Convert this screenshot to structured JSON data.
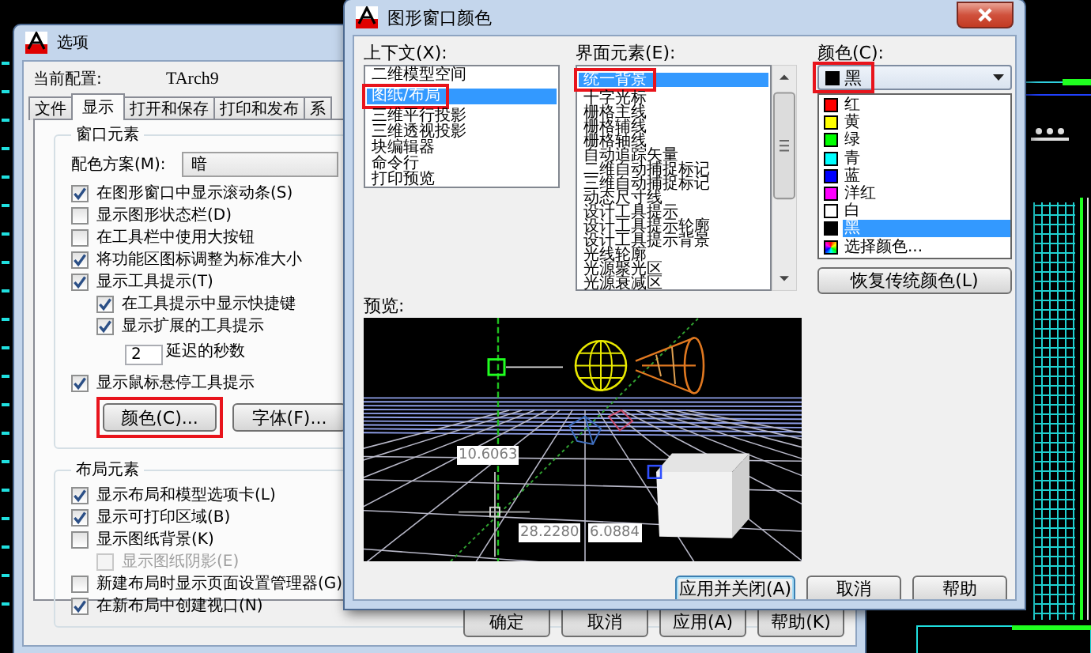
{
  "options_dialog": {
    "title": "选项",
    "profile_label": "当前配置:",
    "profile_value": "TArch9",
    "tabs": [
      {
        "label": "文件",
        "selected": false
      },
      {
        "label": "显示",
        "selected": true
      },
      {
        "label": "打开和保存",
        "selected": false
      },
      {
        "label": "打印和发布",
        "selected": false
      },
      {
        "label": "系",
        "selected": false
      }
    ],
    "window_group": {
      "title": "窗口元素",
      "scheme_label": "配色方案(M):",
      "scheme_value": "暗",
      "options": [
        {
          "kind": "check",
          "label": "在图形窗口中显示滚动条(S)",
          "checked": true,
          "disabled": false
        },
        {
          "kind": "check",
          "label": "显示图形状态栏(D)",
          "checked": false,
          "disabled": false
        },
        {
          "kind": "check",
          "label": "在工具栏中使用大按钮",
          "checked": false,
          "disabled": false
        },
        {
          "kind": "check",
          "label": "将功能区图标调整为标准大小",
          "checked": true,
          "disabled": false
        },
        {
          "kind": "check",
          "label": "显示工具提示(T)",
          "checked": true,
          "disabled": false,
          "children": [
            {
              "kind": "check",
              "label": "在工具提示中显示快捷键",
              "checked": true,
              "disabled": false
            },
            {
              "kind": "check",
              "label": "显示扩展的工具提示",
              "checked": true,
              "disabled": false
            },
            {
              "kind": "number",
              "value": "2",
              "suffix": "延迟的秒数"
            }
          ]
        },
        {
          "kind": "check",
          "label": "显示鼠标悬停工具提示",
          "checked": true,
          "disabled": false
        }
      ],
      "buttons": [
        {
          "label": "颜色(C)...",
          "highlighted": true
        },
        {
          "label": "字体(F)...",
          "highlighted": false
        }
      ]
    },
    "layout_group": {
      "title": "布局元素",
      "options": [
        {
          "kind": "check",
          "label": "显示布局和模型选项卡(L)",
          "checked": true,
          "disabled": false
        },
        {
          "kind": "check",
          "label": "显示可打印区域(B)",
          "checked": true,
          "disabled": false
        },
        {
          "kind": "check",
          "label": "显示图纸背景(K)",
          "checked": false,
          "disabled": false,
          "children": [
            {
              "kind": "check",
              "label": "显示图纸阴影(E)",
              "checked": false,
              "disabled": true
            }
          ]
        },
        {
          "kind": "check",
          "label": "新建布局时显示页面设置管理器(G)",
          "checked": false,
          "disabled": false
        },
        {
          "kind": "check",
          "label": "在新布局中创建视口(N)",
          "checked": true,
          "disabled": false
        }
      ]
    },
    "footer_buttons": [
      "确定",
      "取消",
      "应用(A)",
      "帮助(K)"
    ]
  },
  "color_dialog": {
    "title": "图形窗口颜色",
    "context": {
      "label": "上下文(X):",
      "highlight_selected": true,
      "items": [
        {
          "label": "二维模型空间",
          "selected": false
        },
        {
          "label": "图纸/布局",
          "selected": true
        },
        {
          "label": "三维平行投影",
          "selected": false
        },
        {
          "label": "三维透视投影",
          "selected": false
        },
        {
          "label": "块编辑器",
          "selected": false
        },
        {
          "label": "命令行",
          "selected": false
        },
        {
          "label": "打印预览",
          "selected": false
        }
      ]
    },
    "elements": {
      "label": "界面元素(E):",
      "highlight_selected": true,
      "items": [
        {
          "label": "统一背景",
          "selected": true
        },
        {
          "label": "十字光标",
          "selected": false
        },
        {
          "label": "栅格主线",
          "selected": false
        },
        {
          "label": "栅格辅线",
          "selected": false
        },
        {
          "label": "栅格轴线",
          "selected": false
        },
        {
          "label": "自动追踪矢量",
          "selected": false
        },
        {
          "label": "二维自动捕捉标记",
          "selected": false
        },
        {
          "label": "三维自动捕捉标记",
          "selected": false
        },
        {
          "label": "动态尺寸线",
          "selected": false
        },
        {
          "label": "设计工具提示",
          "selected": false
        },
        {
          "label": "设计工具提示轮廓",
          "selected": false
        },
        {
          "label": "设计工具提示背景",
          "selected": false
        },
        {
          "label": "光线轮廓",
          "selected": false
        },
        {
          "label": "光源聚光区",
          "selected": false
        },
        {
          "label": "光源衰减区",
          "selected": false
        }
      ]
    },
    "color": {
      "label": "颜色(C):",
      "value": "黑",
      "highlighted": true,
      "options": [
        {
          "kind": "swatch",
          "label": "红",
          "color": "#ff0000",
          "selected": false
        },
        {
          "kind": "swatch",
          "label": "黄",
          "color": "#ffff00",
          "selected": false
        },
        {
          "kind": "swatch",
          "label": "绿",
          "color": "#00ff00",
          "selected": false
        },
        {
          "kind": "swatch",
          "label": "青",
          "color": "#00ffff",
          "selected": false
        },
        {
          "kind": "swatch",
          "label": "蓝",
          "color": "#0000ff",
          "selected": false
        },
        {
          "kind": "swatch",
          "label": "洋红",
          "color": "#ff00ff",
          "selected": false
        },
        {
          "kind": "swatch",
          "label": "白",
          "color": "#ffffff",
          "selected": false
        },
        {
          "kind": "swatch",
          "label": "黑",
          "color": "#000000",
          "selected": true
        },
        {
          "kind": "picker",
          "label": "选择颜色...",
          "selected": false
        }
      ]
    },
    "restore_button": "恢复传统颜色(L)",
    "preview": {
      "label": "预览:",
      "dimension_labels": [
        "10.6063",
        "28.2280",
        "6.0884"
      ]
    },
    "buttons": [
      "应用并关闭(A)",
      "取消",
      "帮助"
    ]
  }
}
